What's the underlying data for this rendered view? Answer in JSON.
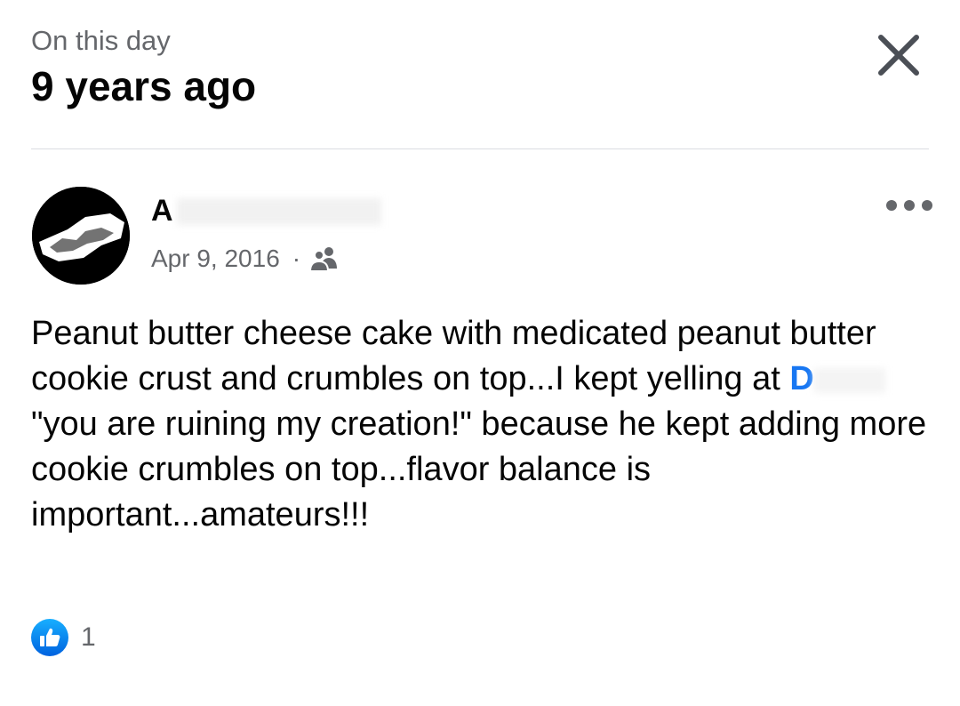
{
  "header": {
    "subtitle": "On this day",
    "title": "9 years ago"
  },
  "post": {
    "author_visible": "A",
    "date": "Apr 9, 2016",
    "separator": "·",
    "audience_icon": "friends-icon",
    "body_part1": "Peanut butter cheese cake with medicated peanut butter cookie crust and crumbles on top...I kept yelling at ",
    "mention_visible": "D",
    "body_part2": " \"you are ruining my creation!\" because he kept adding more cookie crumbles on top...flavor balance is important...amateurs!!!"
  },
  "reactions": {
    "icon": "like-icon",
    "count": "1"
  },
  "colors": {
    "accent": "#1877f2",
    "secondary_text": "#65676b",
    "primary_text": "#050505"
  }
}
